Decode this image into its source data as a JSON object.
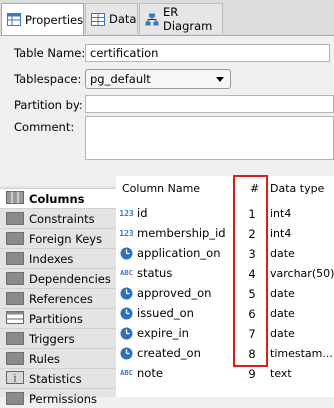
{
  "tabs": [
    {
      "label": "Properties",
      "icon": "table-icon",
      "active": true
    },
    {
      "label": "Data",
      "icon": "data-grid-icon",
      "active": false
    },
    {
      "label": "ER Diagram",
      "icon": "er-diagram-icon",
      "active": false
    }
  ],
  "form": {
    "table_name_label": "Table Name:",
    "table_name_value": "certification",
    "tablespace_label": "Tablespace:",
    "tablespace_value": "pg_default",
    "partition_label": "Partition by:",
    "partition_value": "",
    "comment_label": "Comment:"
  },
  "sidebar": {
    "items": [
      {
        "label": "Columns",
        "active": true,
        "icon": "columns-icon"
      },
      {
        "label": "Constraints",
        "icon": "constraints-icon"
      },
      {
        "label": "Foreign Keys",
        "icon": "foreign-keys-icon"
      },
      {
        "label": "Indexes",
        "icon": "indexes-icon"
      },
      {
        "label": "Dependencies",
        "icon": "dependencies-icon"
      },
      {
        "label": "References",
        "icon": "references-icon"
      },
      {
        "label": "Partitions",
        "icon": "partitions-icon"
      },
      {
        "label": "Triggers",
        "icon": "triggers-icon"
      },
      {
        "label": "Rules",
        "icon": "rules-icon"
      },
      {
        "label": "Statistics",
        "icon": "statistics-icon"
      },
      {
        "label": "Permissions",
        "icon": "permissions-icon"
      }
    ]
  },
  "table": {
    "headers": {
      "name": "Column Name",
      "num": "#",
      "type": "Data type"
    },
    "rows": [
      {
        "icon": "123",
        "name": "id",
        "num": "1",
        "type": "int4"
      },
      {
        "icon": "123",
        "name": "membership_id",
        "num": "2",
        "type": "int4"
      },
      {
        "icon": "clock",
        "name": "application_on",
        "num": "3",
        "type": "date"
      },
      {
        "icon": "ABC",
        "name": "status",
        "num": "4",
        "type": "varchar(50)"
      },
      {
        "icon": "clock",
        "name": "approved_on",
        "num": "5",
        "type": "date"
      },
      {
        "icon": "clock",
        "name": "issued_on",
        "num": "6",
        "type": "date"
      },
      {
        "icon": "clock",
        "name": "expire_in",
        "num": "7",
        "type": "date"
      },
      {
        "icon": "clock",
        "name": "created_on",
        "num": "8",
        "type": "timestam..."
      },
      {
        "icon": "ABC",
        "name": "note",
        "num": "9",
        "type": "text"
      }
    ]
  },
  "colors": {
    "highlight": "#e01b1b",
    "accent": "#3a78c8"
  }
}
